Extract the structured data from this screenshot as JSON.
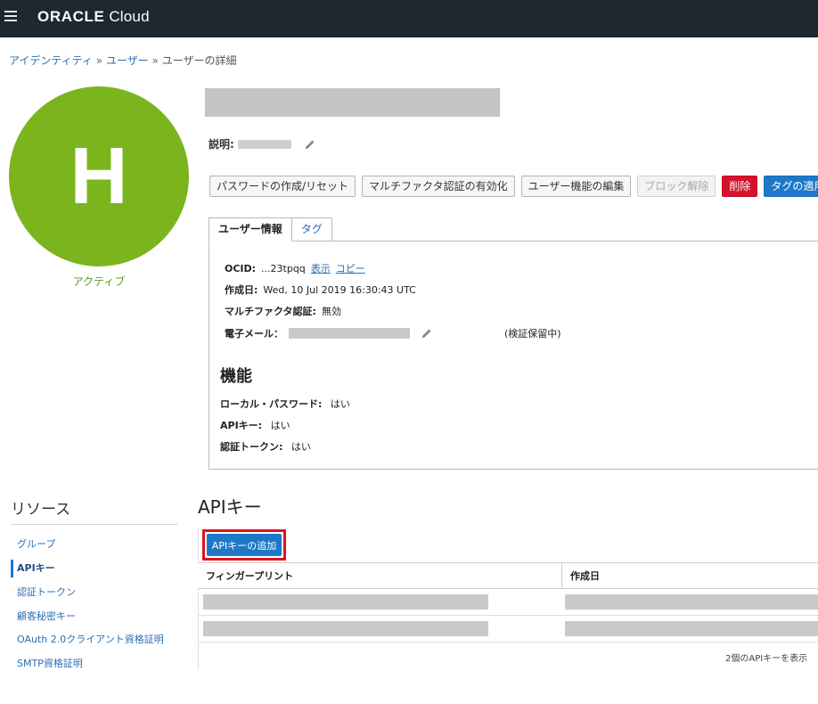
{
  "topbar": {
    "brand_strong": "ORACLE",
    "brand_light": " Cloud"
  },
  "breadcrumb": {
    "item1": "アイデンティティ",
    "sep": " » ",
    "item2": "ユーザー",
    "current": "ユーザーの詳細"
  },
  "avatar": {
    "letter": "H",
    "color": "#7ab51d",
    "status": "アクティブ"
  },
  "description": {
    "label": "説明:"
  },
  "actions": {
    "create_password": "パスワードの作成/リセット",
    "enable_mfa": "マルチファクタ認証の有効化",
    "edit_capabilities": "ユーザー機能の編集",
    "unblock": "ブロック解除",
    "delete": "削除",
    "apply_tags": "タグの適用"
  },
  "tabs": {
    "user_info": "ユーザー情報",
    "tags": "タグ"
  },
  "user_info": {
    "ocid_label": "OCID:",
    "ocid_value": "...23tpqq",
    "show_link": "表示",
    "copy_link": "コピー",
    "created_label": "作成日:",
    "created_value": "Wed, 10 Jul 2019 16:30:43 UTC",
    "mfa_label": "マルチファクタ認証:",
    "mfa_value": "無効",
    "email_label": "電子メール：",
    "email_status": "(検証保留中)"
  },
  "capabilities": {
    "title": "機能",
    "local_password_label": "ローカル・パスワード:",
    "local_password_value": "はい",
    "api_key_label": "APIキー:",
    "api_key_value": "はい",
    "auth_token_label": "認証トークン:",
    "auth_token_value": "はい"
  },
  "resources": {
    "title": "リソース",
    "items": [
      {
        "label": "グループ"
      },
      {
        "label": "APIキー"
      },
      {
        "label": "認証トークン"
      },
      {
        "label": "顧客秘密キー"
      },
      {
        "label": "OAuth 2.0クライアント資格証明"
      },
      {
        "label": "SMTP資格証明"
      }
    ]
  },
  "api_keys": {
    "title": "APIキー",
    "add_button": "APIキーの追加",
    "col_fingerprint": "フィンガープリント",
    "col_created": "作成日",
    "footer": "2個のAPIキーを表示"
  }
}
